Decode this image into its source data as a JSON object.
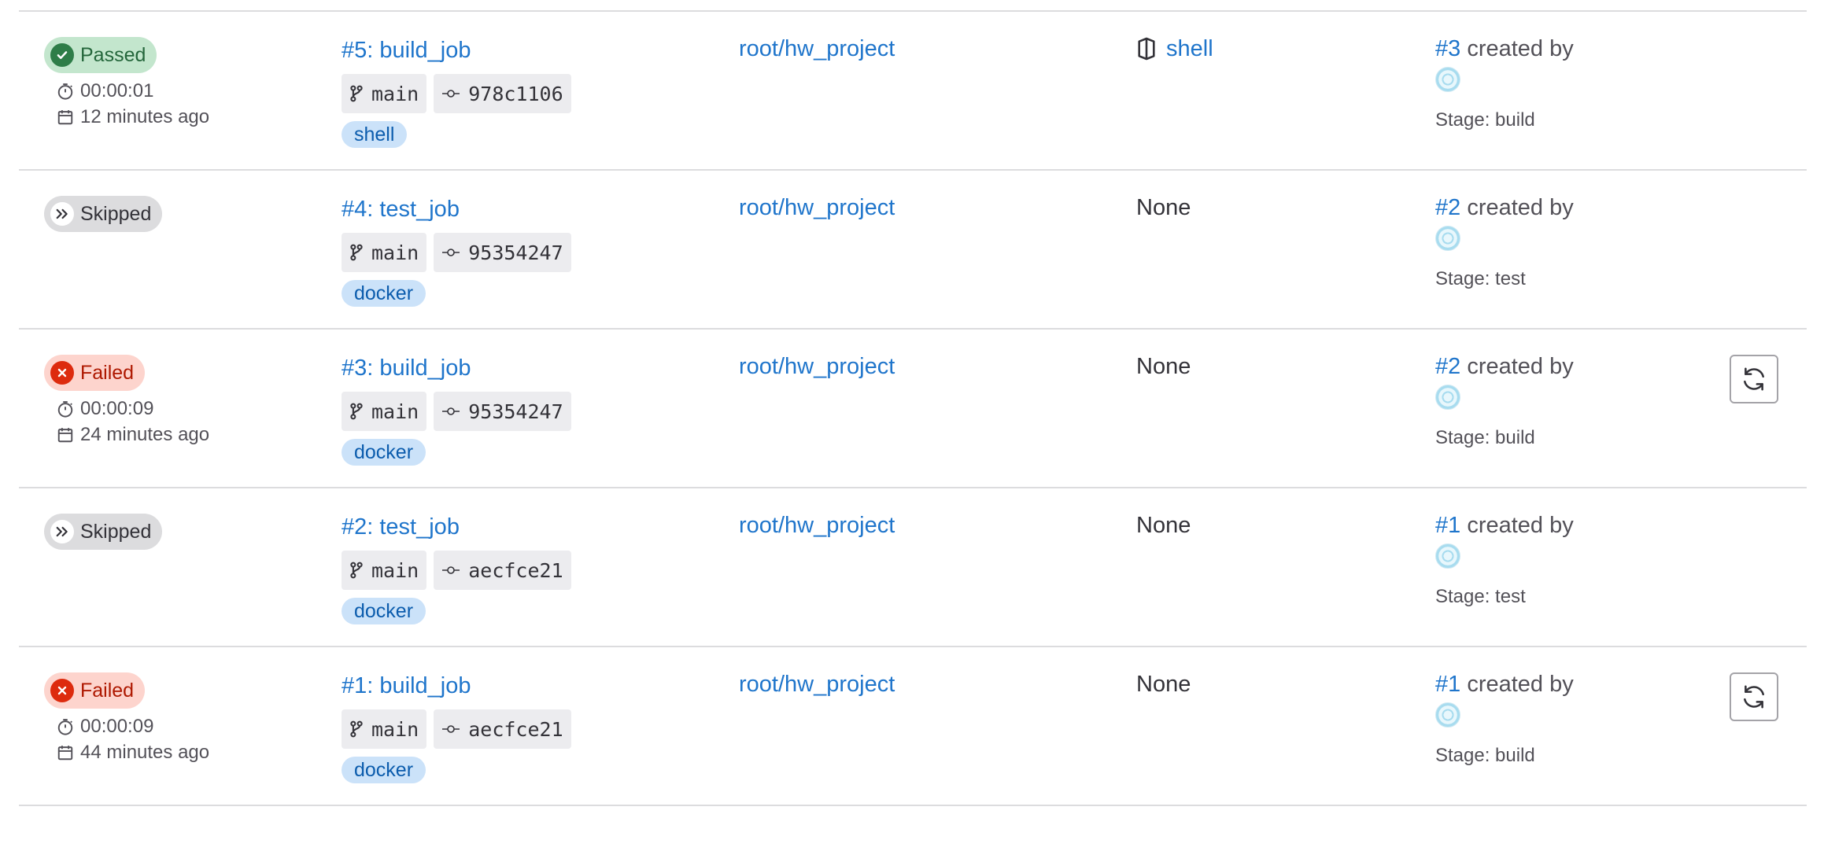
{
  "jobs": [
    {
      "status": "Passed",
      "status_kind": "success",
      "duration": "00:00:01",
      "finished": "12 minutes ago",
      "title": "#5: build_job",
      "branch": "main",
      "commit": "978c1106",
      "tag": "shell",
      "project": "root/hw_project",
      "runner": "shell",
      "pipeline_id": "#3",
      "created_by": "created by",
      "stage": "Stage: build",
      "retry": false
    },
    {
      "status": "Skipped",
      "status_kind": "skipped",
      "duration": "",
      "finished": "",
      "title": "#4: test_job",
      "branch": "main",
      "commit": "95354247",
      "tag": "docker",
      "project": "root/hw_project",
      "runner": "None",
      "pipeline_id": "#2",
      "created_by": "created by",
      "stage": "Stage: test",
      "retry": false
    },
    {
      "status": "Failed",
      "status_kind": "failed",
      "duration": "00:00:09",
      "finished": "24 minutes ago",
      "title": "#3: build_job",
      "branch": "main",
      "commit": "95354247",
      "tag": "docker",
      "project": "root/hw_project",
      "runner": "None",
      "pipeline_id": "#2",
      "created_by": "created by",
      "stage": "Stage: build",
      "retry": true
    },
    {
      "status": "Skipped",
      "status_kind": "skipped",
      "duration": "",
      "finished": "",
      "title": "#2: test_job",
      "branch": "main",
      "commit": "aecfce21",
      "tag": "docker",
      "project": "root/hw_project",
      "runner": "None",
      "pipeline_id": "#1",
      "created_by": "created by",
      "stage": "Stage: test",
      "retry": false
    },
    {
      "status": "Failed",
      "status_kind": "failed",
      "duration": "00:00:09",
      "finished": "44 minutes ago",
      "title": "#1: build_job",
      "branch": "main",
      "commit": "aecfce21",
      "tag": "docker",
      "project": "root/hw_project",
      "runner": "None",
      "pipeline_id": "#1",
      "created_by": "created by",
      "stage": "Stage: build",
      "retry": true
    }
  ],
  "icons": {
    "success": "check-circle-icon",
    "failed": "close-circle-icon",
    "skipped": "double-chevron-right-icon",
    "duration": "timer-icon",
    "finished": "calendar-icon",
    "branch": "branch-icon",
    "commit": "commit-icon",
    "runner": "runner-icon",
    "retry": "retry-icon"
  },
  "colors": {
    "link": "#1f75cb",
    "success": "#2e7d48",
    "failed": "#dd2b0e",
    "skipped": "#dcdcde",
    "tag_bg": "#cbe2f9"
  }
}
